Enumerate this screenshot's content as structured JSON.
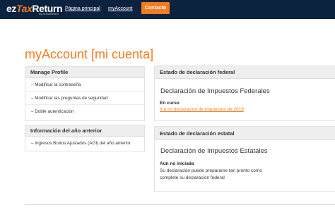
{
  "logo": {
    "ez": "ez",
    "tax": "Tax",
    "return": "Return",
    "sub": "by ezTaxReturn"
  },
  "nav": {
    "home": "Página principal",
    "account": "myAccount",
    "contact": "Contacto"
  },
  "page": {
    "title": "myAccount [mi cuenta]"
  },
  "profile": {
    "header": "Manage Profile",
    "links": [
      "– Modificar la contraseña",
      "– Modificar las preguntas de seguridad",
      "– Doble autenticación"
    ]
  },
  "previous_year": {
    "header": "Información del año anterior",
    "links": [
      "– Ingresos Brutos Ajustados (AGI) del año anterior"
    ]
  },
  "federal": {
    "header": "Estado de declaración federal",
    "title": "Declaración de Impuestos Federales",
    "status": "En curso",
    "link": "Ir a mi declaración de impuestos de 2019"
  },
  "state": {
    "header": "Estado de declaración estatal",
    "title": "Declaración de Impuestos Estatales",
    "status": "Aún no iniciada",
    "description": "Su declaración puede prepararse tan pronto como complete su declaración federal"
  },
  "colors": {
    "navy": "#0c2340",
    "accent": "#f47b20"
  }
}
